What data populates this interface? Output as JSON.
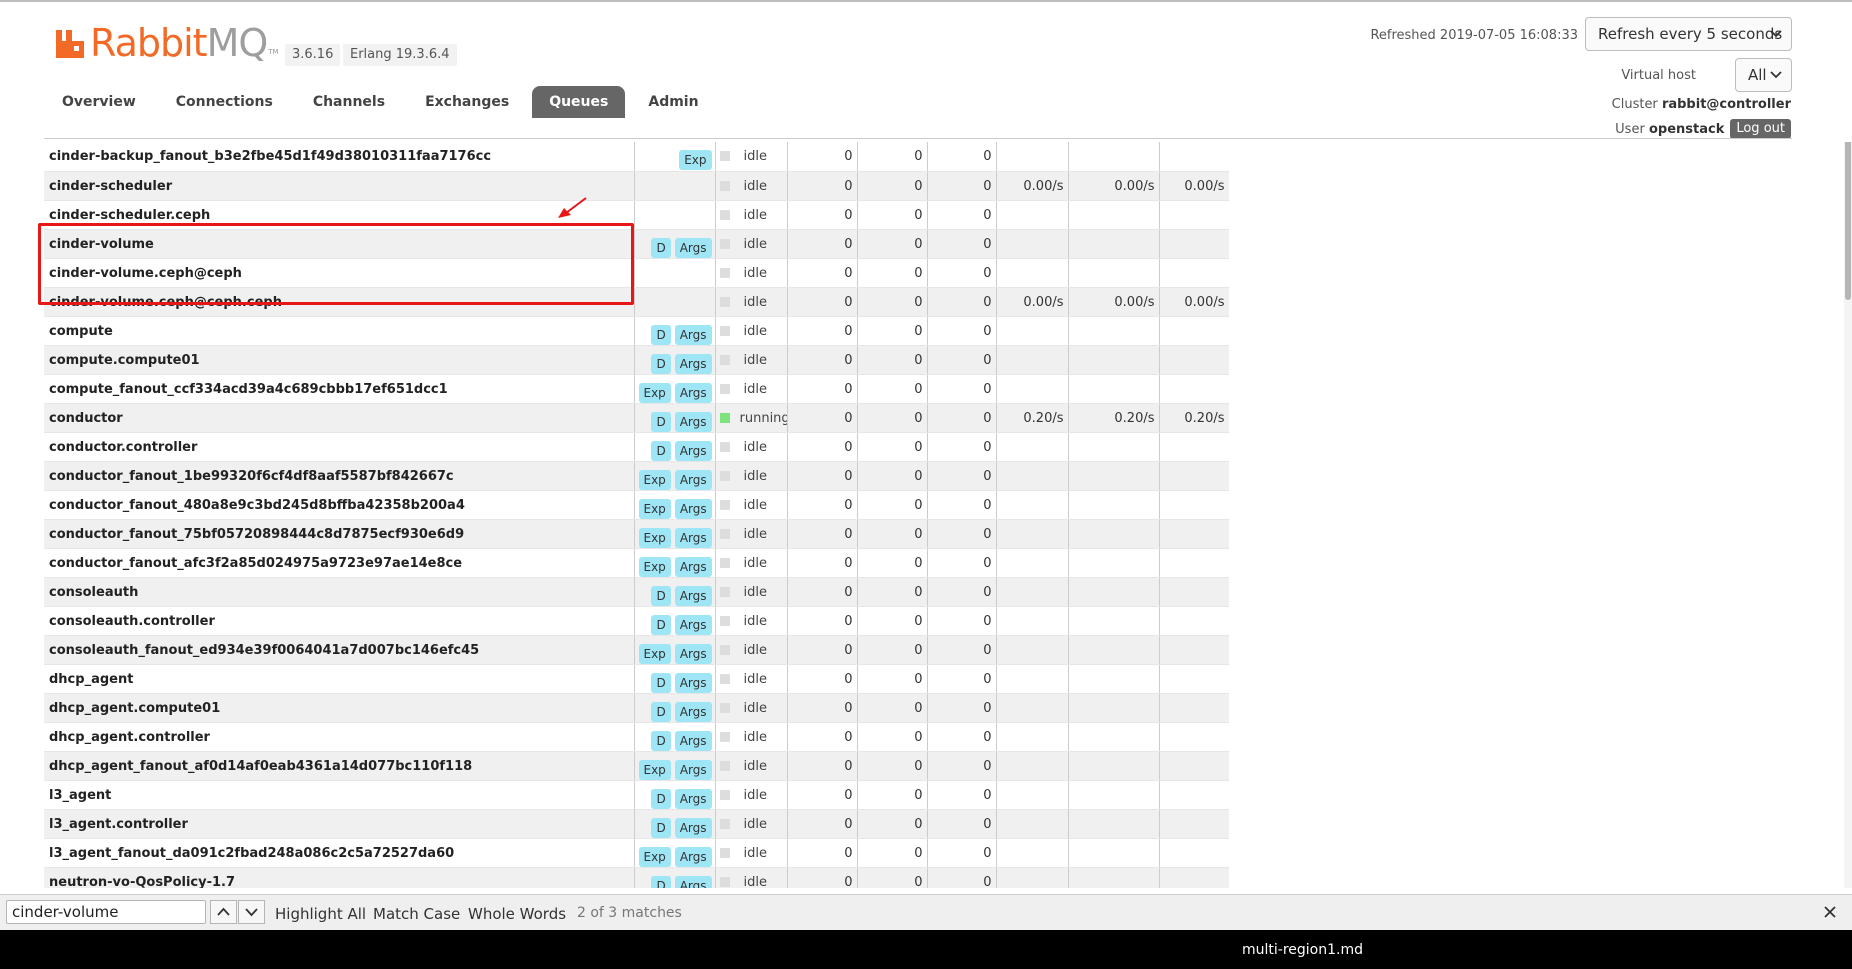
{
  "app": {
    "brand_rabbit": "Rabbit",
    "brand_mq": "MQ",
    "trademark": "TM",
    "version": "3.6.16",
    "erlang": "Erlang 19.3.6.4"
  },
  "nav": {
    "tabs": [
      {
        "label": "Overview",
        "active": false
      },
      {
        "label": "Connections",
        "active": false
      },
      {
        "label": "Channels",
        "active": false
      },
      {
        "label": "Exchanges",
        "active": false
      },
      {
        "label": "Queues",
        "active": true
      },
      {
        "label": "Admin",
        "active": false
      }
    ]
  },
  "header": {
    "refreshed": "Refreshed 2019-07-05 16:08:33",
    "refresh_select": "Refresh every 5 seconds",
    "vhost_label": "Virtual host",
    "vhost_value": "All",
    "cluster_label": "Cluster",
    "cluster_value": "rabbit@controller",
    "user_label": "User",
    "user_value": "openstack",
    "logout": "Log out"
  },
  "colors": {
    "brand_orange": "#f26a25",
    "badge_blue": "#9ee5f6",
    "highlight_red": "#e81616",
    "running_green": "#7ee27e",
    "active_tab": "#666666"
  },
  "queues": {
    "rows": [
      {
        "name": "cinder-backup_fanout_b3e2fbe45d1f49d38010311faa7176cc",
        "features": [
          "Exp"
        ],
        "state": "idle",
        "ready": "0",
        "unacked": "0",
        "total": "0",
        "incoming": "",
        "deliver": "",
        "ack": ""
      },
      {
        "name": "cinder-scheduler",
        "features": [],
        "state": "idle",
        "ready": "0",
        "unacked": "0",
        "total": "0",
        "incoming": "0.00/s",
        "deliver": "0.00/s",
        "ack": "0.00/s"
      },
      {
        "name": "cinder-scheduler.ceph",
        "features": [],
        "state": "idle",
        "ready": "0",
        "unacked": "0",
        "total": "0",
        "incoming": "",
        "deliver": "",
        "ack": ""
      },
      {
        "name": "cinder-volume",
        "features": [
          "D",
          "Args"
        ],
        "state": "idle",
        "ready": "0",
        "unacked": "0",
        "total": "0",
        "incoming": "",
        "deliver": "",
        "ack": ""
      },
      {
        "name": "cinder-volume.ceph@ceph",
        "features": [],
        "state": "idle",
        "ready": "0",
        "unacked": "0",
        "total": "0",
        "incoming": "",
        "deliver": "",
        "ack": ""
      },
      {
        "name": "cinder-volume.ceph@ceph.ceph",
        "features": [],
        "state": "idle",
        "ready": "0",
        "unacked": "0",
        "total": "0",
        "incoming": "0.00/s",
        "deliver": "0.00/s",
        "ack": "0.00/s"
      },
      {
        "name": "compute",
        "features": [
          "D",
          "Args"
        ],
        "state": "idle",
        "ready": "0",
        "unacked": "0",
        "total": "0",
        "incoming": "",
        "deliver": "",
        "ack": ""
      },
      {
        "name": "compute.compute01",
        "features": [
          "D",
          "Args"
        ],
        "state": "idle",
        "ready": "0",
        "unacked": "0",
        "total": "0",
        "incoming": "",
        "deliver": "",
        "ack": ""
      },
      {
        "name": "compute_fanout_ccf334acd39a4c689cbbb17ef651dcc1",
        "features": [
          "Exp",
          "Args"
        ],
        "state": "idle",
        "ready": "0",
        "unacked": "0",
        "total": "0",
        "incoming": "",
        "deliver": "",
        "ack": ""
      },
      {
        "name": "conductor",
        "features": [
          "D",
          "Args"
        ],
        "state": "running",
        "ready": "0",
        "unacked": "0",
        "total": "0",
        "incoming": "0.20/s",
        "deliver": "0.20/s",
        "ack": "0.20/s"
      },
      {
        "name": "conductor.controller",
        "features": [
          "D",
          "Args"
        ],
        "state": "idle",
        "ready": "0",
        "unacked": "0",
        "total": "0",
        "incoming": "",
        "deliver": "",
        "ack": ""
      },
      {
        "name": "conductor_fanout_1be99320f6cf4df8aaf5587bf842667c",
        "features": [
          "Exp",
          "Args"
        ],
        "state": "idle",
        "ready": "0",
        "unacked": "0",
        "total": "0",
        "incoming": "",
        "deliver": "",
        "ack": ""
      },
      {
        "name": "conductor_fanout_480a8e9c3bd245d8bffba42358b200a4",
        "features": [
          "Exp",
          "Args"
        ],
        "state": "idle",
        "ready": "0",
        "unacked": "0",
        "total": "0",
        "incoming": "",
        "deliver": "",
        "ack": ""
      },
      {
        "name": "conductor_fanout_75bf05720898444c8d7875ecf930e6d9",
        "features": [
          "Exp",
          "Args"
        ],
        "state": "idle",
        "ready": "0",
        "unacked": "0",
        "total": "0",
        "incoming": "",
        "deliver": "",
        "ack": ""
      },
      {
        "name": "conductor_fanout_afc3f2a85d024975a9723e97ae14e8ce",
        "features": [
          "Exp",
          "Args"
        ],
        "state": "idle",
        "ready": "0",
        "unacked": "0",
        "total": "0",
        "incoming": "",
        "deliver": "",
        "ack": ""
      },
      {
        "name": "consoleauth",
        "features": [
          "D",
          "Args"
        ],
        "state": "idle",
        "ready": "0",
        "unacked": "0",
        "total": "0",
        "incoming": "",
        "deliver": "",
        "ack": ""
      },
      {
        "name": "consoleauth.controller",
        "features": [
          "D",
          "Args"
        ],
        "state": "idle",
        "ready": "0",
        "unacked": "0",
        "total": "0",
        "incoming": "",
        "deliver": "",
        "ack": ""
      },
      {
        "name": "consoleauth_fanout_ed934e39f0064041a7d007bc146efc45",
        "features": [
          "Exp",
          "Args"
        ],
        "state": "idle",
        "ready": "0",
        "unacked": "0",
        "total": "0",
        "incoming": "",
        "deliver": "",
        "ack": ""
      },
      {
        "name": "dhcp_agent",
        "features": [
          "D",
          "Args"
        ],
        "state": "idle",
        "ready": "0",
        "unacked": "0",
        "total": "0",
        "incoming": "",
        "deliver": "",
        "ack": ""
      },
      {
        "name": "dhcp_agent.compute01",
        "features": [
          "D",
          "Args"
        ],
        "state": "idle",
        "ready": "0",
        "unacked": "0",
        "total": "0",
        "incoming": "",
        "deliver": "",
        "ack": ""
      },
      {
        "name": "dhcp_agent.controller",
        "features": [
          "D",
          "Args"
        ],
        "state": "idle",
        "ready": "0",
        "unacked": "0",
        "total": "0",
        "incoming": "",
        "deliver": "",
        "ack": ""
      },
      {
        "name": "dhcp_agent_fanout_af0d14af0eab4361a14d077bc110f118",
        "features": [
          "Exp",
          "Args"
        ],
        "state": "idle",
        "ready": "0",
        "unacked": "0",
        "total": "0",
        "incoming": "",
        "deliver": "",
        "ack": ""
      },
      {
        "name": "l3_agent",
        "features": [
          "D",
          "Args"
        ],
        "state": "idle",
        "ready": "0",
        "unacked": "0",
        "total": "0",
        "incoming": "",
        "deliver": "",
        "ack": ""
      },
      {
        "name": "l3_agent.controller",
        "features": [
          "D",
          "Args"
        ],
        "state": "idle",
        "ready": "0",
        "unacked": "0",
        "total": "0",
        "incoming": "",
        "deliver": "",
        "ack": ""
      },
      {
        "name": "l3_agent_fanout_da091c2fbad248a086c2c5a72527da60",
        "features": [
          "Exp",
          "Args"
        ],
        "state": "idle",
        "ready": "0",
        "unacked": "0",
        "total": "0",
        "incoming": "",
        "deliver": "",
        "ack": ""
      },
      {
        "name": "neutron-vo-QosPolicy-1.7",
        "features": [
          "D",
          "Args"
        ],
        "state": "idle",
        "ready": "0",
        "unacked": "0",
        "total": "0",
        "incoming": "",
        "deliver": "",
        "ack": ""
      }
    ]
  },
  "findbar": {
    "query": "cinder-volume",
    "highlight_all": "Highlight All",
    "match_case": "Match Case",
    "whole_words": "Whole Words",
    "matches": "2 of 3 matches"
  },
  "taskbar": {
    "window_label": "multi-region1.md"
  }
}
